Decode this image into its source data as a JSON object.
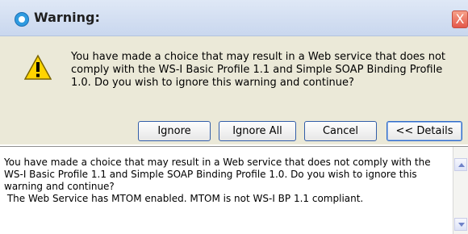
{
  "window": {
    "title": "Warning:",
    "close_glyph": "X",
    "accent_color": "#2f9be0"
  },
  "message": {
    "icon": "warning-icon",
    "text": "You have made a choice that may result in a Web service that does not comply with the WS-I Basic Profile 1.1 and Simple SOAP Binding Profile 1.0. Do you wish to ignore this warning and continue?"
  },
  "buttons": {
    "ignore": "Ignore",
    "ignore_all": "Ignore All",
    "cancel": "Cancel",
    "details": "<< Details"
  },
  "details": {
    "text": "You have made a choice that may result in a Web service that does not comply with the WS-I Basic Profile 1.1 and Simple SOAP Binding Profile 1.0. Do you wish to ignore this warning and continue?\n The Web Service has MTOM enabled. MTOM is not WS-I BP 1.1 compliant."
  }
}
